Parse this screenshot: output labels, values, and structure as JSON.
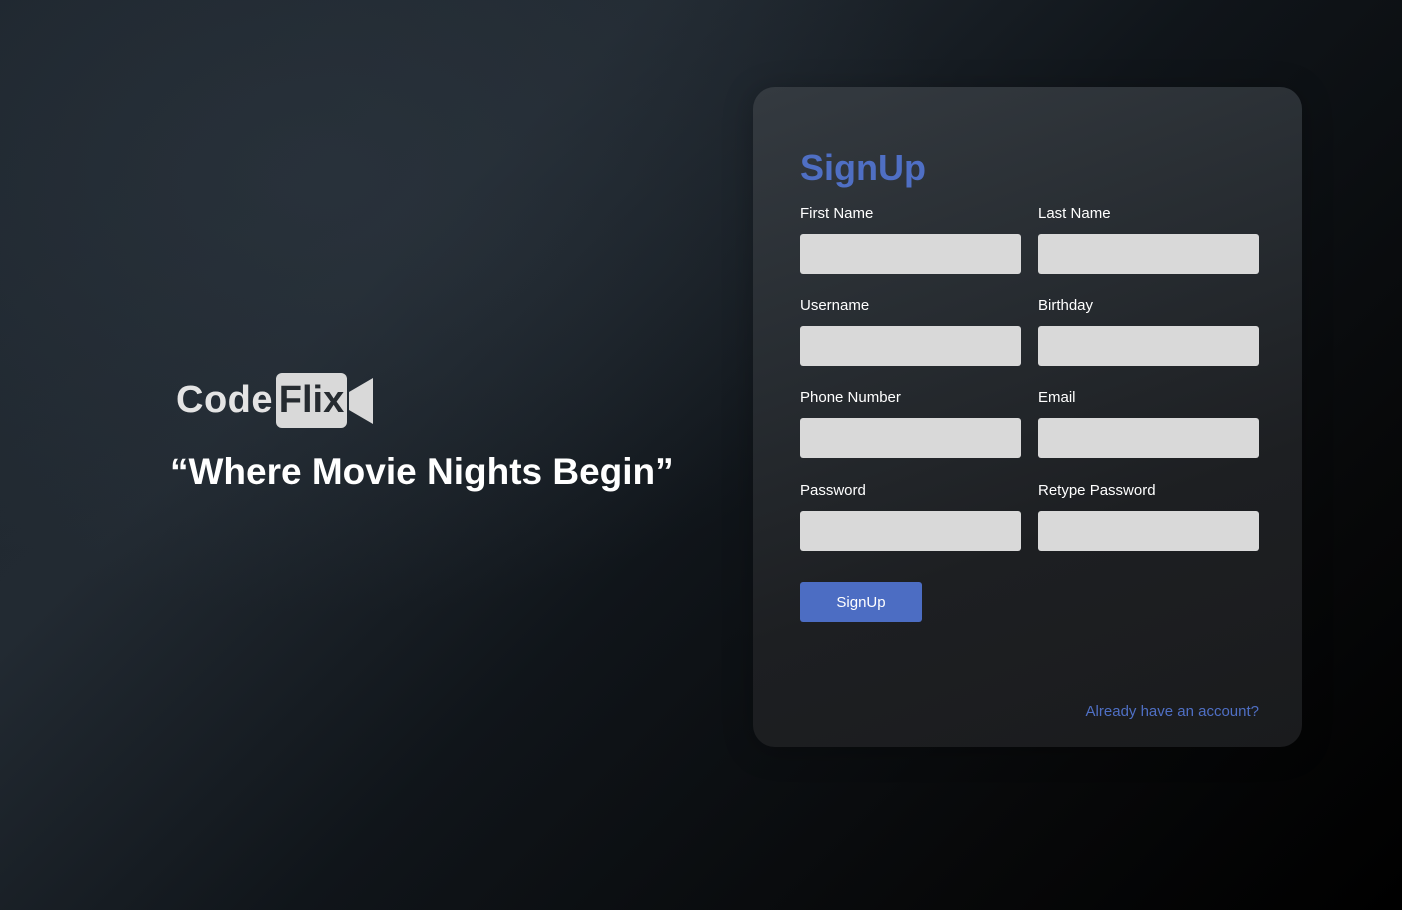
{
  "brand": {
    "name_part1": "Code",
    "name_part2": "Flix",
    "logo_icon": "video-camera-icon",
    "tagline": "“Where Movie Nights Begin”"
  },
  "signup_form": {
    "title": "SignUp",
    "fields": [
      {
        "label": "First Name",
        "value": "",
        "placeholder": ""
      },
      {
        "label": "Last Name",
        "value": "",
        "placeholder": ""
      },
      {
        "label": "Username",
        "value": "",
        "placeholder": ""
      },
      {
        "label": "Birthday",
        "value": "",
        "placeholder": ""
      },
      {
        "label": "Phone Number",
        "value": "",
        "placeholder": ""
      },
      {
        "label": "Email",
        "value": "",
        "placeholder": ""
      },
      {
        "label": "Password",
        "value": "",
        "placeholder": ""
      },
      {
        "label": "Retype Password",
        "value": "",
        "placeholder": ""
      }
    ],
    "submit_label": "SignUp",
    "login_link": "Already have an account?"
  },
  "colors": {
    "accent": "#4f6fc4",
    "button": "#4c6dc3",
    "input_bg": "#d9d9d9",
    "card_bg": "#272c31",
    "logo_light": "#d9d9d9"
  }
}
